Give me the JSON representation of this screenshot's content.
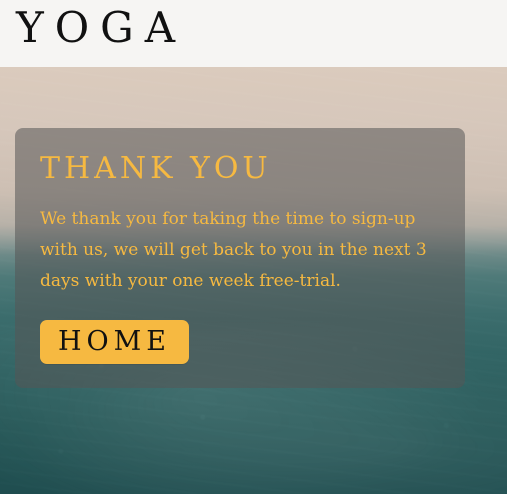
{
  "header": {
    "logo_text": "YOGA"
  },
  "thank_you_card": {
    "title": "THANK YOU",
    "message": "We thank you for taking the time to sign-up with us, we will get back to you in the next 3 days with your one week free-trial.",
    "home_button_label": "HOME"
  },
  "colors": {
    "accent": "#f6b941",
    "header_background": "#f6f5f3",
    "card_background": "#555555",
    "text_dark": "#111111"
  }
}
